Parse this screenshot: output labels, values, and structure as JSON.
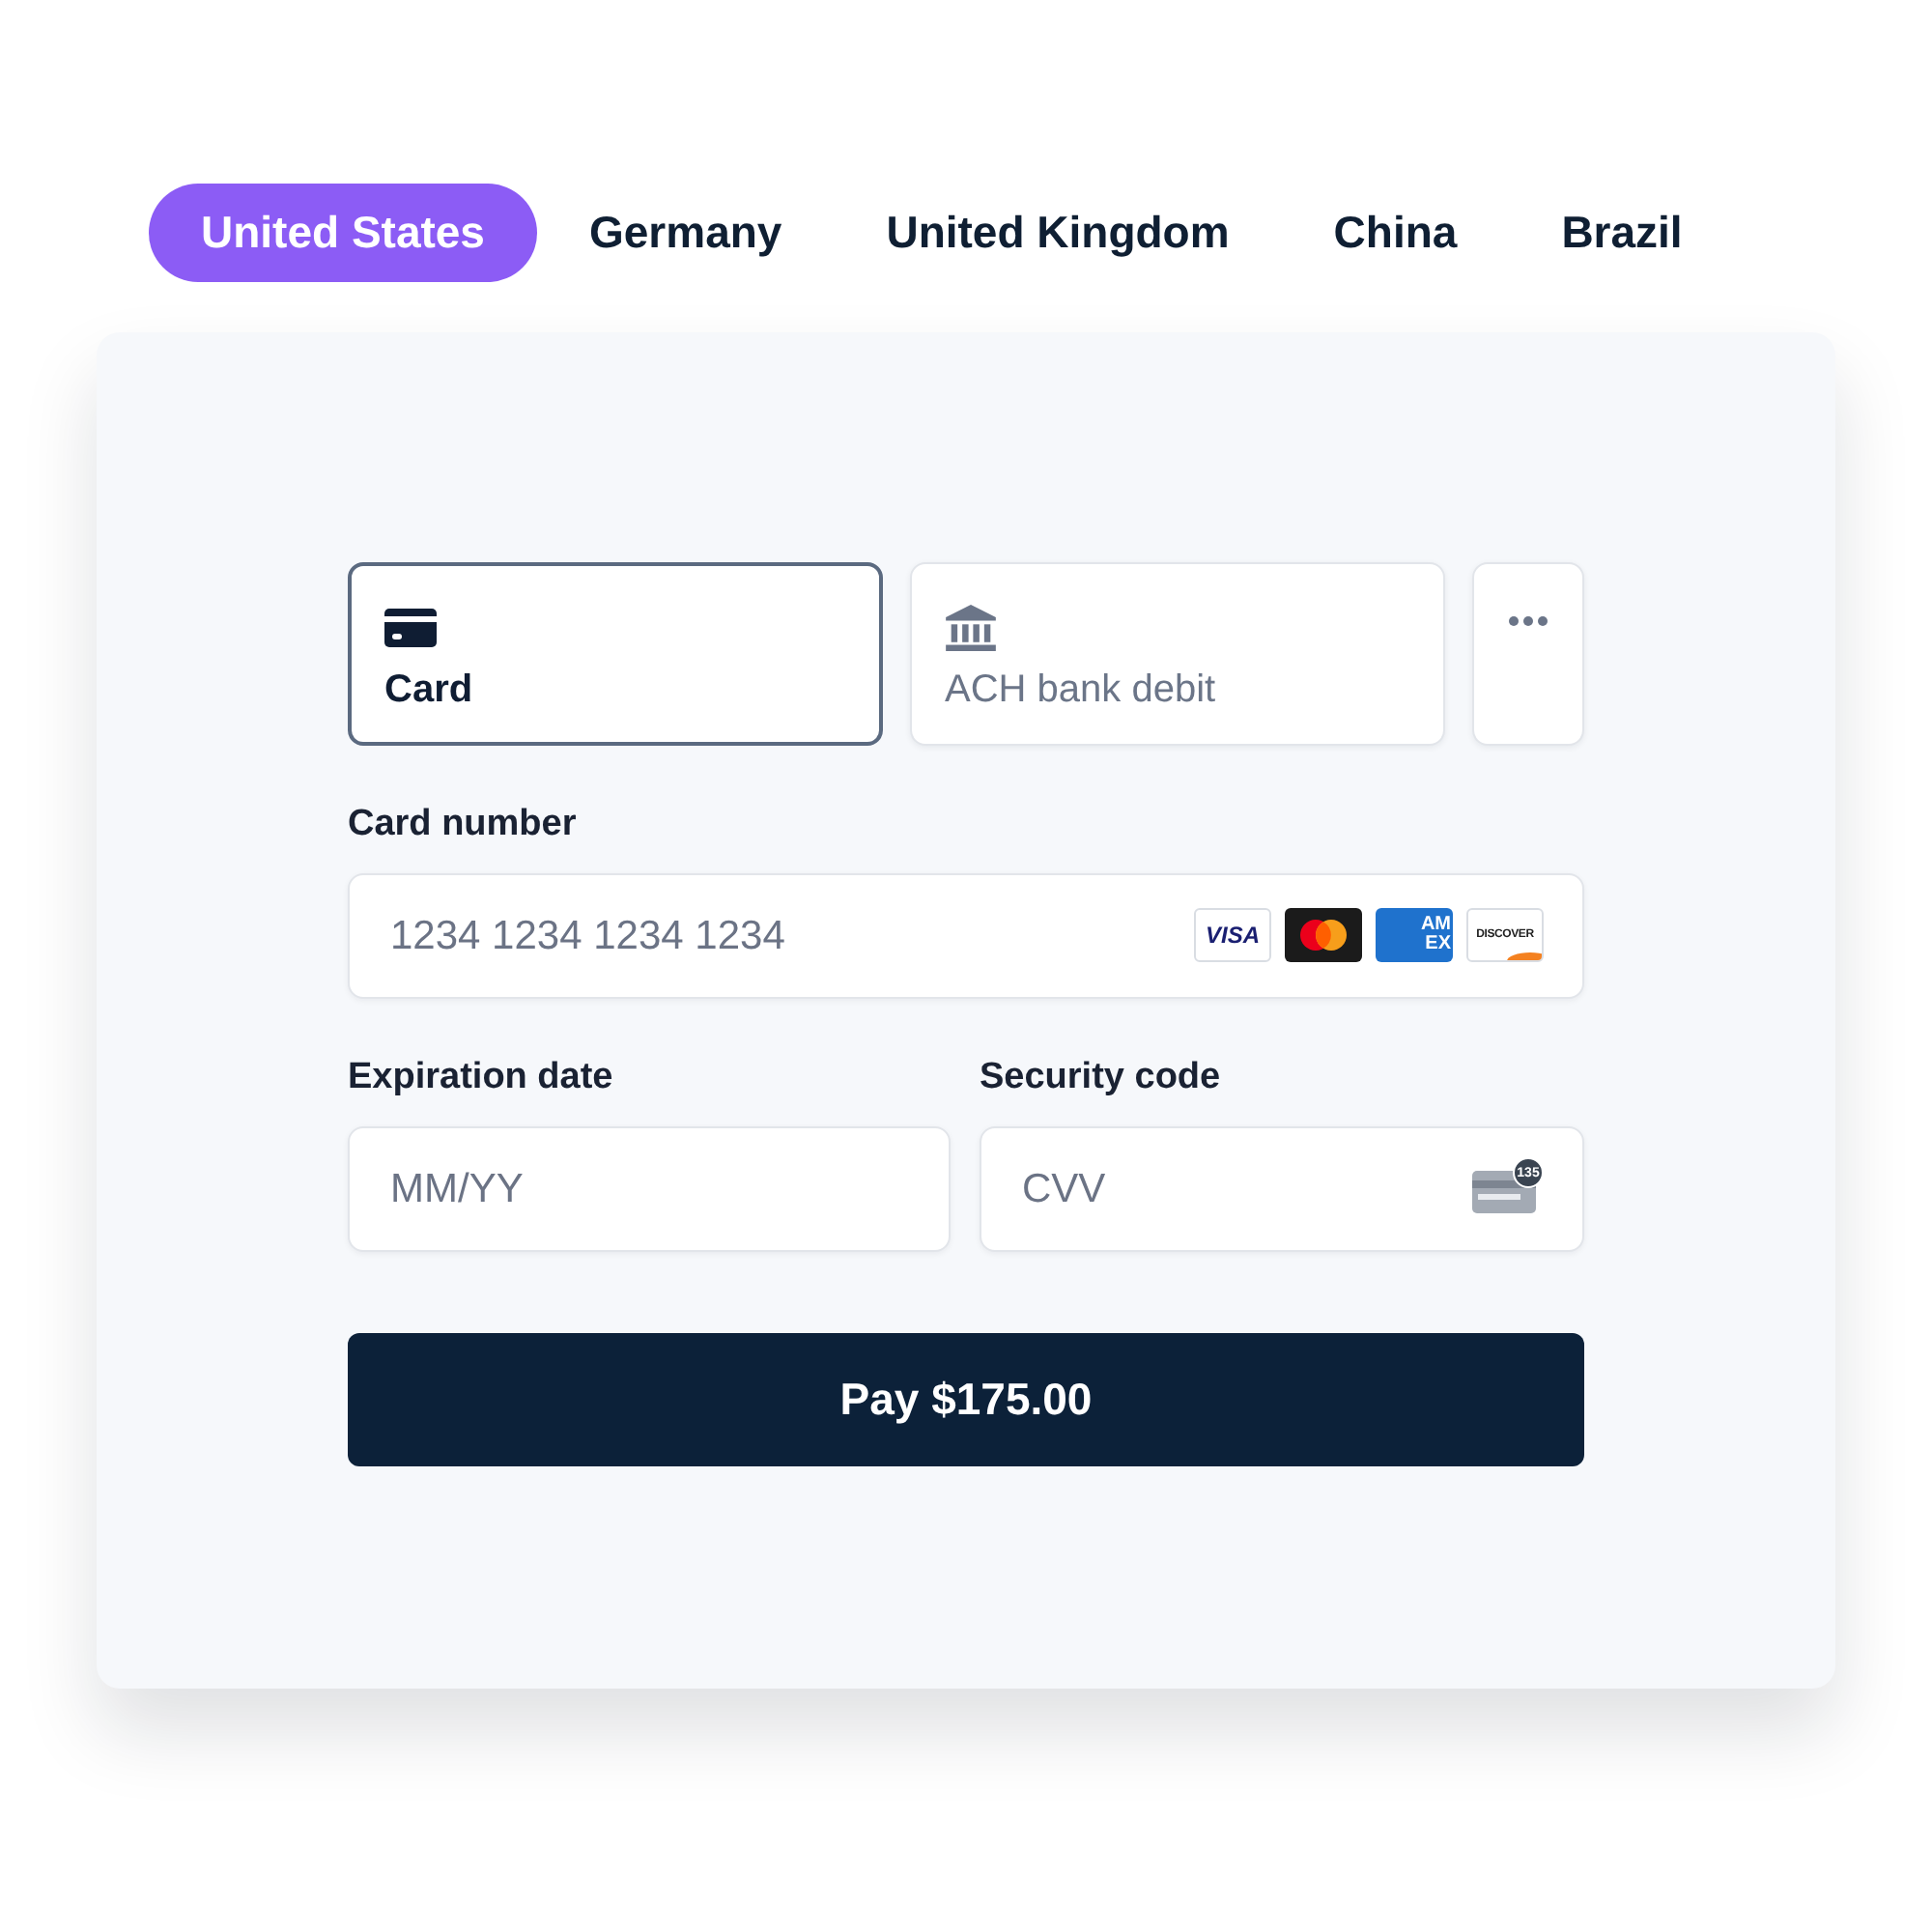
{
  "tabs": [
    {
      "label": "United States",
      "selected": true
    },
    {
      "label": "Germany",
      "selected": false
    },
    {
      "label": "United Kingdom",
      "selected": false
    },
    {
      "label": "China",
      "selected": false
    },
    {
      "label": "Brazil",
      "selected": false
    }
  ],
  "payment_methods": [
    {
      "kind": "card",
      "label": "Card",
      "selected": true
    },
    {
      "kind": "bank",
      "label": "ACH bank debit",
      "selected": false
    },
    {
      "kind": "more",
      "selected": false
    }
  ],
  "card_number": {
    "label": "Card number",
    "placeholder": "1234 1234 1234 1234",
    "brands": [
      {
        "kind": "visa",
        "text": "VISA"
      },
      {
        "kind": "mastercard"
      },
      {
        "kind": "amex",
        "lines": [
          "AM",
          "EX"
        ]
      },
      {
        "kind": "discover",
        "text": "DISCOVER"
      }
    ]
  },
  "expiration": {
    "label": "Expiration date",
    "placeholder": "MM/YY"
  },
  "security_code": {
    "label": "Security code",
    "placeholder": "CVV",
    "hint_badge": "135"
  },
  "pay_button": {
    "label": "Pay $175.00"
  }
}
